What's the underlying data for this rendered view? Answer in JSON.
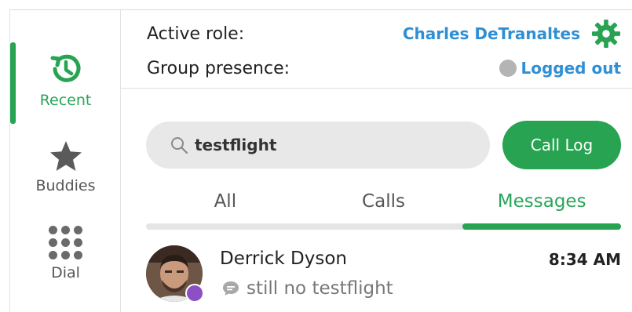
{
  "sidebar": {
    "items": [
      {
        "label": "Recent",
        "icon": "history-icon",
        "active": true
      },
      {
        "label": "Buddies",
        "icon": "star-icon",
        "active": false
      },
      {
        "label": "Dial",
        "icon": "dialpad-icon",
        "active": false
      }
    ]
  },
  "header": {
    "active_role_label": "Active role:",
    "active_role_value": "Charles DeTranaltes",
    "group_presence_label": "Group presence:",
    "group_presence_value": "Logged out",
    "settings_icon": "gear-icon"
  },
  "search": {
    "value": "testflight",
    "icon": "search-icon"
  },
  "call_log_label": "Call Log",
  "tabs": [
    {
      "label": "All",
      "active": false
    },
    {
      "label": "Calls",
      "active": false
    },
    {
      "label": "Messages",
      "active": true
    }
  ],
  "messages": [
    {
      "name": "Derrick Dyson",
      "time": "8:34 AM",
      "preview": "still no testflight"
    }
  ],
  "colors": {
    "accent_green": "#27a352",
    "link_blue": "#2f8fd4",
    "presence_gray": "#b4b4b4",
    "badge_purple": "#8d4fc4"
  }
}
